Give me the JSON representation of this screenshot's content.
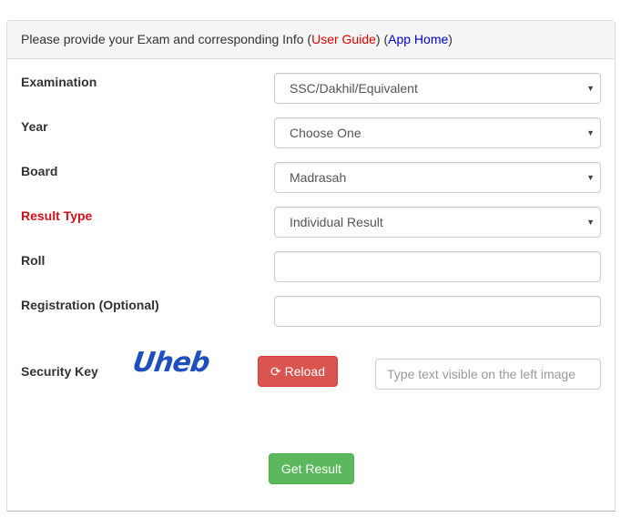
{
  "header": {
    "text": "Please provide your Exam and corresponding Info",
    "open_paren1": " (",
    "user_guide_label": "User Guide",
    "close_paren1": ")",
    "open_paren2": " (",
    "app_home_label": "App Home",
    "close_paren2": ")"
  },
  "form": {
    "examination": {
      "label": "Examination",
      "value": "SSC/Dakhil/Equivalent"
    },
    "year": {
      "label": "Year",
      "value": "Choose One"
    },
    "board": {
      "label": "Board",
      "value": "Madrasah"
    },
    "result_type": {
      "label": "Result Type",
      "value": "Individual Result"
    },
    "roll": {
      "label": "Roll",
      "value": ""
    },
    "registration": {
      "label": "Registration (Optional)",
      "value": ""
    },
    "security_key": {
      "label": "Security Key",
      "captcha_text": "Uheb",
      "reload_label": "Reload",
      "reload_icon": "refresh-icon",
      "input_placeholder": "Type text visible on the left image",
      "input_value": ""
    },
    "submit_label": "Get Result"
  },
  "colors": {
    "result_type_label": "#d0101a",
    "user_guide_link": "#dd0000",
    "app_home_link": "#0000cc",
    "reload_button": "#d9534f",
    "submit_button": "#5cb85c",
    "captcha": "#1e4fbf"
  }
}
